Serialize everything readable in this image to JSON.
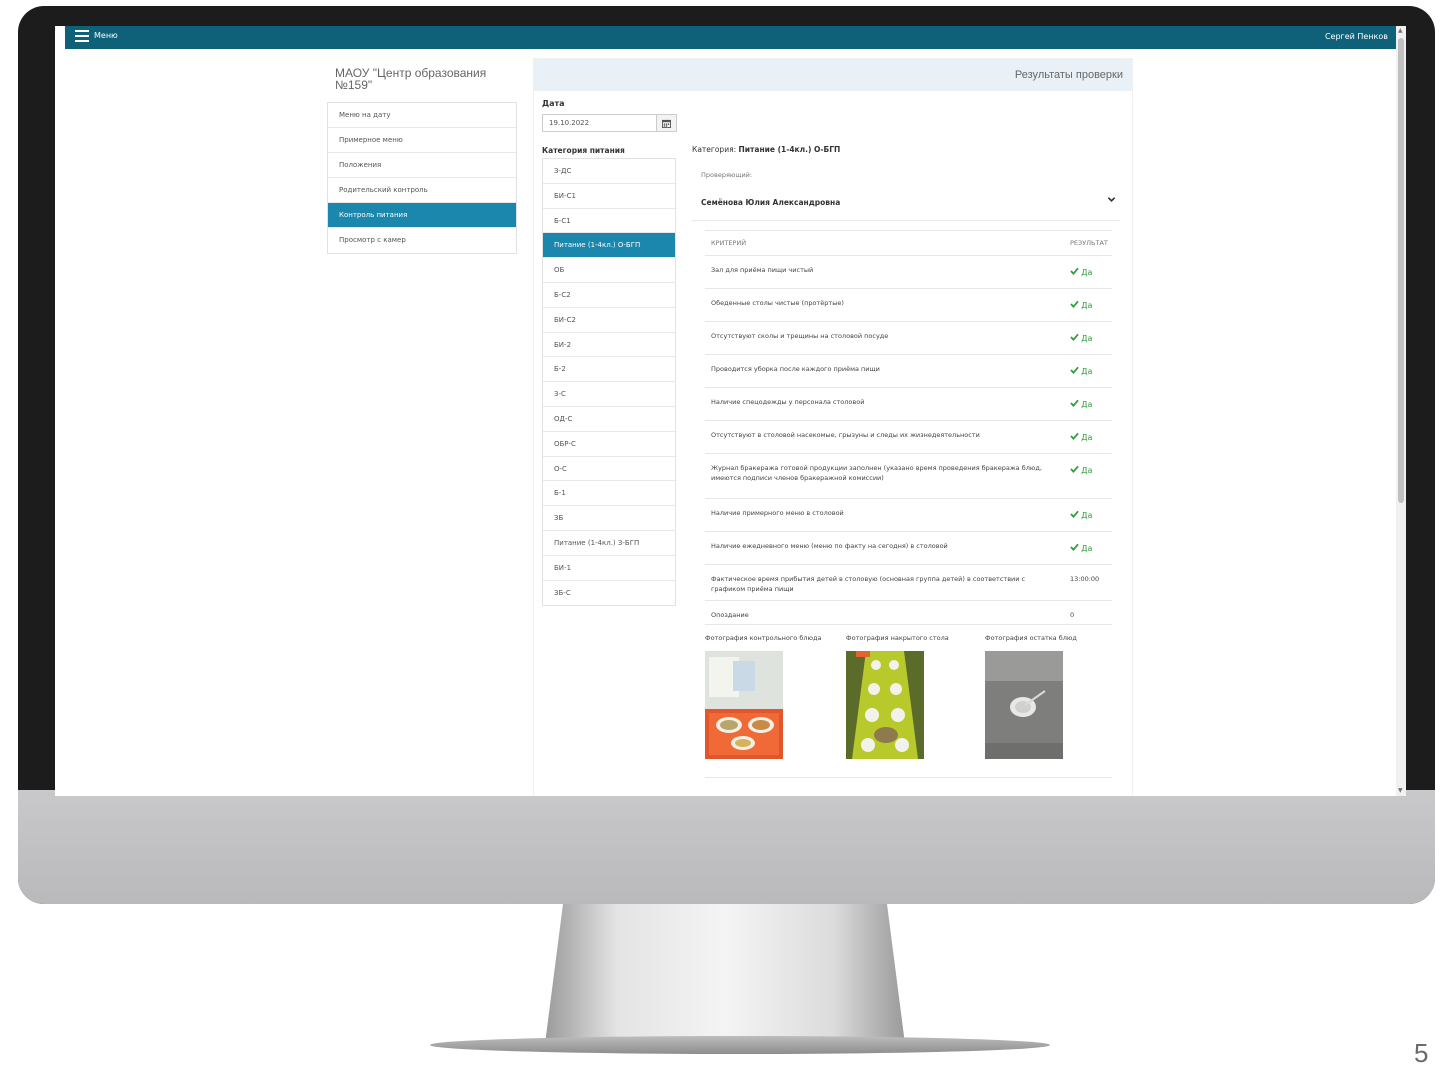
{
  "topbar": {
    "menu_label": "Меню",
    "user_name": "Сергей Пенков"
  },
  "org_title": "МАОУ \"Центр образования №159\"",
  "sidebar": {
    "items": [
      {
        "label": "Меню на дату",
        "active": false
      },
      {
        "label": "Примерное меню",
        "active": false
      },
      {
        "label": "Положения",
        "active": false
      },
      {
        "label": "Родительский контроль",
        "active": false
      },
      {
        "label": "Контроль питания",
        "active": true
      },
      {
        "label": "Просмотр с камер",
        "active": false
      }
    ]
  },
  "panel": {
    "title": "Результаты проверки",
    "date_label": "Дата",
    "date_value": "19.10.2022",
    "calendar_icon": "calendar-icon",
    "category_label": "Категория питания",
    "categories": [
      {
        "label": "З-ДС",
        "active": false
      },
      {
        "label": "БИ-С1",
        "active": false
      },
      {
        "label": "Б-С1",
        "active": false
      },
      {
        "label": "Питание (1-4кл.) О-БГП",
        "active": true
      },
      {
        "label": "ОБ",
        "active": false
      },
      {
        "label": "Б-С2",
        "active": false
      },
      {
        "label": "БИ-С2",
        "active": false
      },
      {
        "label": "БИ-2",
        "active": false
      },
      {
        "label": "Б-2",
        "active": false
      },
      {
        "label": "З-С",
        "active": false
      },
      {
        "label": "ОД-С",
        "active": false
      },
      {
        "label": "ОБР-С",
        "active": false
      },
      {
        "label": "О-С",
        "active": false
      },
      {
        "label": "Б-1",
        "active": false
      },
      {
        "label": "ЗБ",
        "active": false
      },
      {
        "label": "Питание (1-4кл.) З-БГП",
        "active": false
      },
      {
        "label": "БИ-1",
        "active": false
      },
      {
        "label": "ЗБ-С",
        "active": false
      }
    ],
    "category_prefix": "Категория:",
    "category_selected": "Питание (1-4кл.) О-БГП",
    "inspector_label": "Проверяющий:",
    "inspector_name": "Семёнова Юлия Александровна",
    "table": {
      "headers": [
        "КРИТЕРИЙ",
        "РЕЗУЛЬТАТ"
      ],
      "rows": [
        {
          "criterion": "Зал для приёма пищи чистый",
          "result": "Да",
          "check": true
        },
        {
          "criterion": "Обеденные столы чистые (протёртые)",
          "result": "Да",
          "check": true
        },
        {
          "criterion": "Отсутствуют сколы и трещины на столовой посуде",
          "result": "Да",
          "check": true
        },
        {
          "criterion": "Проводится уборка после каждого приёма пищи",
          "result": "Да",
          "check": true
        },
        {
          "criterion": "Наличие спецодежды у персонала столовой",
          "result": "Да",
          "check": true
        },
        {
          "criterion": "Отсутствуют в столовой насекомые, грызуны и следы их жизнедеятельности",
          "result": "Да",
          "check": true
        },
        {
          "criterion": "Журнал бракеража готовой продукции заполнен (указано время проведения бракеража блюд, имеются подписи членов бракеражной комиссии)",
          "result": "Да",
          "check": true
        },
        {
          "criterion": "Наличие примерного меню в столовой",
          "result": "Да",
          "check": true
        },
        {
          "criterion": "Наличие ежедневного меню (меню по факту на сегодня) в столовой",
          "result": "Да",
          "check": true
        },
        {
          "criterion": "Фактическое время прибытия детей в столовую (основная группа детей) в соответствии с графиком приёма пищи",
          "result": "13:00:00",
          "check": false
        },
        {
          "criterion": "Опоздание",
          "result": "0",
          "check": false
        }
      ]
    },
    "photos": [
      {
        "label": "Фотография контрольного блюда",
        "icon": "photo-control-dish"
      },
      {
        "label": "Фотография накрытого стола",
        "icon": "photo-set-table"
      },
      {
        "label": "Фотография остатка блюд",
        "icon": "photo-leftovers"
      }
    ]
  },
  "slide_number": "5",
  "colors": {
    "topbar": "#0e6179",
    "active": "#1b87ad",
    "check": "#2e9d3a"
  }
}
